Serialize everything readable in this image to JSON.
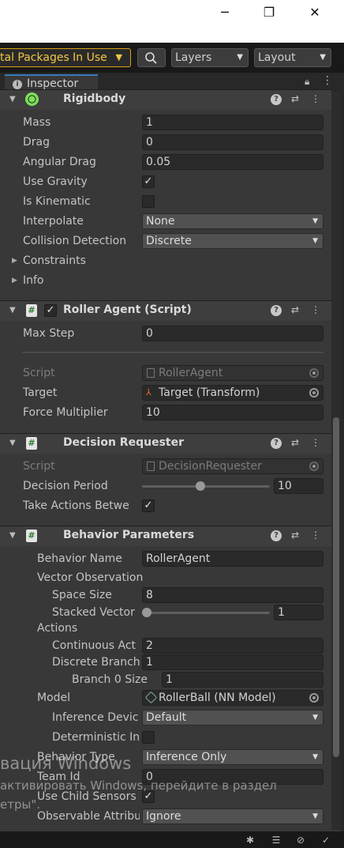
{
  "window": {
    "minimize_glyph": "─",
    "maximize_glyph": "❐",
    "close_glyph": "✕"
  },
  "toolbar": {
    "packages_label": "tal Packages In Use",
    "layers_label": "Layers",
    "layout_label": "Layout"
  },
  "tab": {
    "label": "Inspector"
  },
  "rigidbody": {
    "title": "Rigidbody",
    "mass_label": "Mass",
    "mass_value": "1",
    "drag_label": "Drag",
    "drag_value": "0",
    "angular_drag_label": "Angular Drag",
    "angular_drag_value": "0.05",
    "use_gravity_label": "Use Gravity",
    "use_gravity_checked": true,
    "is_kinematic_label": "Is Kinematic",
    "is_kinematic_checked": false,
    "interpolate_label": "Interpolate",
    "interpolate_value": "None",
    "collision_label": "Collision Detection",
    "collision_value": "Discrete",
    "constraints_label": "Constraints",
    "info_label": "Info"
  },
  "roller_agent": {
    "title": "Roller Agent (Script)",
    "max_step_label": "Max Step",
    "max_step_value": "0",
    "script_label": "Script",
    "script_value": "RollerAgent",
    "target_label": "Target",
    "target_value": "Target (Transform)",
    "force_label": "Force Multiplier",
    "force_value": "10"
  },
  "decision_requester": {
    "title": "Decision Requester",
    "script_label": "Script",
    "script_value": "DecisionRequester",
    "period_label": "Decision Period",
    "period_value": "10",
    "period_fraction": 0.45,
    "take_actions_label": "Take Actions Betwe",
    "take_actions_checked": true
  },
  "behavior_parameters": {
    "title": "Behavior Parameters",
    "behavior_name_label": "Behavior Name",
    "behavior_name_value": "RollerAgent",
    "vector_obs_label": "Vector Observation",
    "space_size_label": "Space Size",
    "space_size_value": "8",
    "stacked_label": "Stacked Vector",
    "stacked_value": "1",
    "stacked_fraction": 0.0,
    "actions_label": "Actions",
    "continuous_label": "Continuous Act",
    "continuous_value": "2",
    "discrete_label": "Discrete Branch",
    "discrete_value": "1",
    "branch0_label": "Branch 0 Size",
    "branch0_value": "1",
    "model_label": "Model",
    "model_value": "RollerBall (NN Model)",
    "inference_label": "Inference Devic",
    "inference_value": "Default",
    "deterministic_label": "Deterministic In",
    "deterministic_checked": false,
    "behavior_type_label": "Behavior Type",
    "behavior_type_value": "Inference Only",
    "team_id_label": "Team Id",
    "team_id_value": "0",
    "child_sensors_label": "Use Child Sensors",
    "child_sensors_checked": true,
    "observable_label": "Observable Attribu",
    "observable_value": "Ignore"
  },
  "watermark": {
    "line1": "вация Windows",
    "line2": "активировать Windows, перейдите в раздел",
    "line3": "етры\"."
  },
  "colors": {
    "accent": "#3a79bb",
    "warning": "#f2c744",
    "panel": "#383838"
  }
}
